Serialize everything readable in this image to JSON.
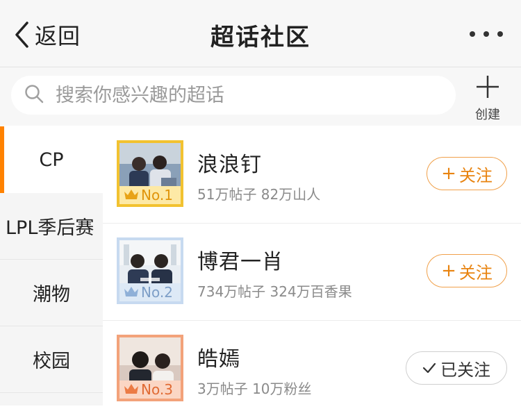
{
  "navbar": {
    "back_label": "返回",
    "title": "超话社区"
  },
  "search": {
    "placeholder": "搜索你感兴趣的超话",
    "create_label": "创建"
  },
  "sidebar": {
    "items": [
      {
        "label": "CP",
        "active": true
      },
      {
        "label": "LPL季后赛",
        "active": false
      },
      {
        "label": "潮物",
        "active": false
      },
      {
        "label": "校园",
        "active": false
      }
    ]
  },
  "topics": [
    {
      "name": "浪浪钉",
      "stats": "51万帖子 82万山人",
      "rank": "No.1",
      "rank_color": "#f2b01e",
      "follow_label": "关注",
      "followed": false
    },
    {
      "name": "博君一肖",
      "stats": "734万帖子 324万百香果",
      "rank": "No.2",
      "rank_color": "#a7c3e6",
      "follow_label": "关注",
      "followed": false
    },
    {
      "name": "皓嫣",
      "stats": "3万帖子 10万粉丝",
      "rank": "No.3",
      "rank_color": "#f08a5d",
      "follow_label": "已关注",
      "followed": true
    }
  ],
  "colors": {
    "accent": "#ff8200",
    "follow_border": "#f0a04a",
    "follow_text": "#e8830f"
  }
}
